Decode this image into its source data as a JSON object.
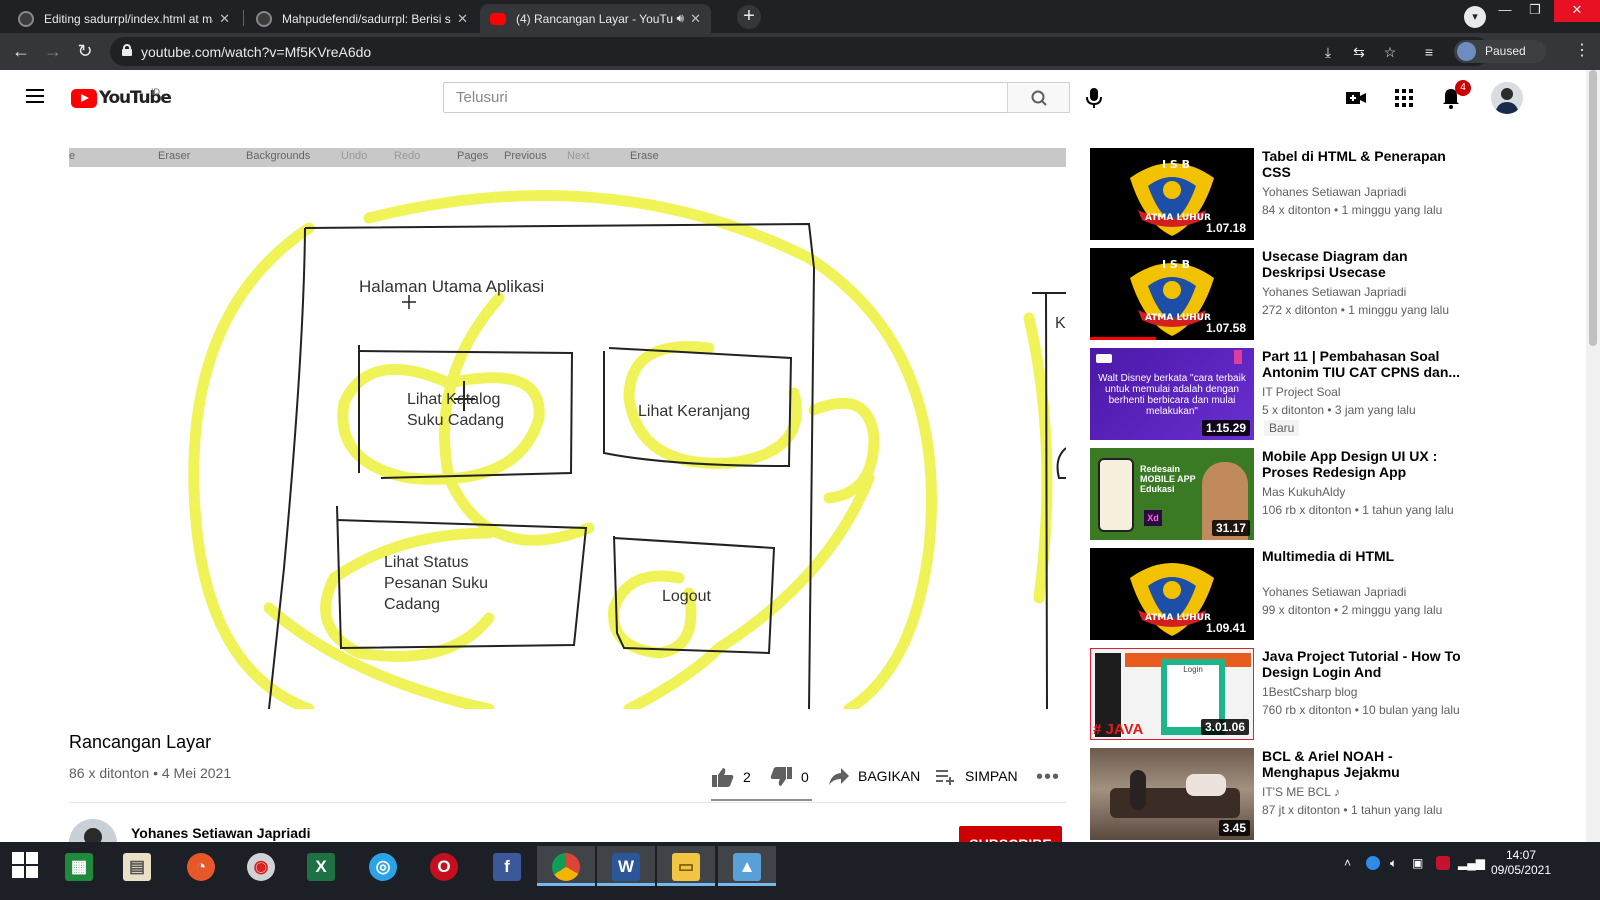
{
  "browser": {
    "tabs": [
      {
        "title": "Editing sadurrpl/index.html at ma",
        "active": false
      },
      {
        "title": "Mahpudefendi/sadurrpl: Berisi sa",
        "active": false
      },
      {
        "title": "(4) Rancangan Layar - YouTu",
        "active": true
      }
    ],
    "url": "youtube.com/watch?v=Mf5KVreA6do",
    "profile_label": "Paused"
  },
  "youtube": {
    "logo_text": "YouTube",
    "country_code": "ID",
    "search_placeholder": "Telusuri",
    "notification_count": "4"
  },
  "video": {
    "sheet_toolbar": [
      "e",
      "Eraser",
      "Backgrounds",
      "Undo",
      "Redo",
      "Pages",
      "Previous",
      "Next",
      "Erase"
    ],
    "sketch": {
      "heading": "Halaman Utama Aplikasi",
      "box1": [
        "Lihat Katalog",
        "Suku Cadang"
      ],
      "box2": "Lihat Keranjang",
      "box3": [
        "Lihat Status",
        "Pesanan Suku",
        "Cadang"
      ],
      "box4": "Logout",
      "edge_letter": "K"
    },
    "title": "Rancangan Layar",
    "views": "86 x ditonton",
    "date": "4 Mei 2021",
    "likes": "2",
    "dislikes": "0",
    "share_label": "BAGIKAN",
    "save_label": "SIMPAN",
    "channel_name": "Yohanes Setiawan Japriadi",
    "subscribe_label": "SUBSCRIBE"
  },
  "recommendations": [
    {
      "title": "Tabel di HTML & Penerapan CSS",
      "channel": "Yohanes Setiawan Japriadi",
      "views": "84 x ditonton",
      "age": "1 minggu yang lalu",
      "duration": "1.07.18",
      "thumb": "atma"
    },
    {
      "title": "Usecase Diagram dan Deskripsi Usecase",
      "channel": "Yohanes Setiawan Japriadi",
      "views": "272 x ditonton",
      "age": "1 minggu yang lalu",
      "duration": "1.07.58",
      "thumb": "atma",
      "watched": 0.4
    },
    {
      "title": "Part 11 | Pembahasan Soal Antonim TIU CAT CPNS dan...",
      "channel": "IT Project Soal",
      "views": "5 x ditonton",
      "age": "3 jam yang lalu",
      "duration": "1.15.29",
      "thumb": "purple",
      "badge": "Baru",
      "thumb_text": "Walt Disney berkata \"cara terbaik untuk memulai adalah dengan berhenti berbicara dan mulai melakukan\""
    },
    {
      "title": "Mobile App Design UI UX : Proses Redesign App Edukasi...",
      "channel": "Mas KukuhAldy",
      "views": "106 rb x ditonton",
      "age": "1 tahun yang lalu",
      "duration": "31.17",
      "thumb": "green",
      "thumb_text": "Redesain MOBILE APP Edukasi"
    },
    {
      "title": "Multimedia di HTML",
      "channel": "Yohanes Setiawan Japriadi",
      "views": "99 x ditonton",
      "age": "2 minggu yang lalu",
      "duration": "1.09.41",
      "thumb": "atma"
    },
    {
      "title": "Java Project Tutorial - How To Design Login And Dashboard...",
      "channel": "1BestCsharp blog",
      "views": "760 rb x ditonton",
      "age": "10 bulan yang lalu",
      "duration": "3.01.06",
      "thumb": "java",
      "thumb_text": "# JAVA"
    },
    {
      "title": "BCL & Ariel NOAH - Menghapus Jejakmu",
      "channel": "IT'S ME BCL ♪",
      "views": "87 jt x ditonton",
      "age": "1 tahun yang lalu",
      "duration": "3.45",
      "thumb": "photo"
    }
  ],
  "taskbar": {
    "clock_time": "14:07",
    "clock_date": "09/05/2021"
  },
  "colors": {
    "youtube_red": "#ff0000",
    "highlighter_yellow": "#eef23c",
    "chrome_dark": "#202124",
    "taskbar": "#1c1f26"
  }
}
